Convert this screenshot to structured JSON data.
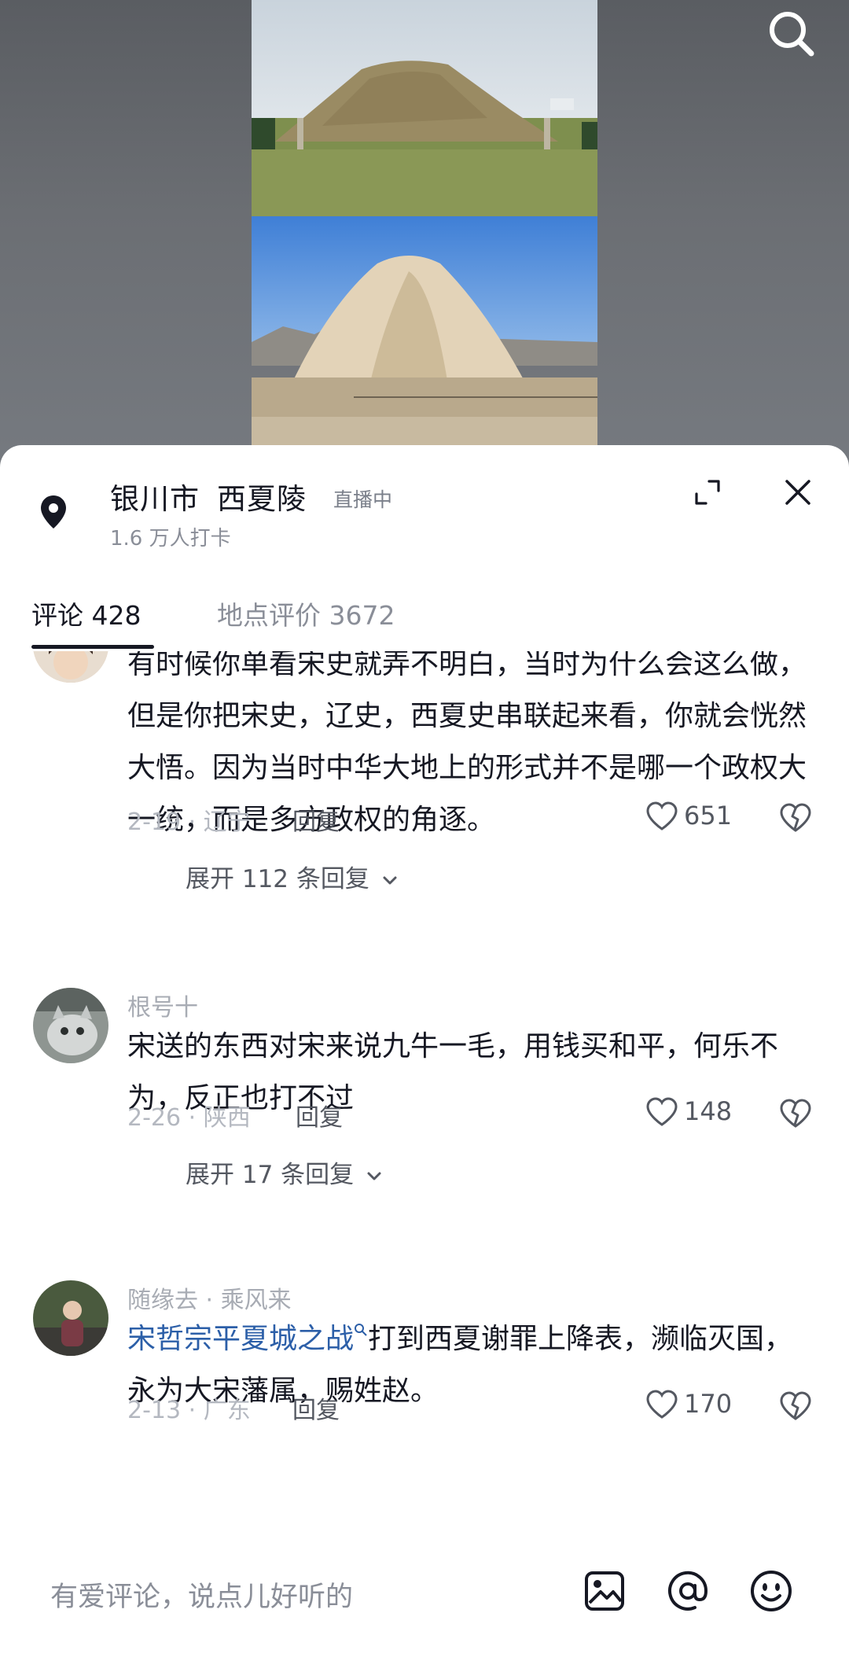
{
  "location": {
    "city": "银川市",
    "place": "西夏陵",
    "live_badge": "直播中",
    "checkins": "1.6 万人打卡"
  },
  "tabs": [
    {
      "label": "评论 428",
      "active": true
    },
    {
      "label": "地点评价 3672",
      "active": false
    }
  ],
  "comments": [
    {
      "text": "有时候你单看宋史就弄不明白，当时为什么会这么做，但是你把宋史，辽史，西夏史串联起来看，你就会恍然大悟。因为当时中华大地上的形式并不是哪一个政权大一统，而是多方政权的角逐。",
      "meta": "2-19 · 辽宁",
      "reply": "回复",
      "likes": "651",
      "expand": "展开 112 条回复"
    },
    {
      "username": "根号十",
      "text": "宋送的东西对宋来说九牛一毛，用钱买和平，何乐不为，反正也打不过",
      "meta": "2-26 · 陕西",
      "reply": "回复",
      "likes": "148",
      "expand": "展开 17 条回复"
    },
    {
      "username": "随缘去 · 乘风来",
      "tag": "宋哲宗平夏城之战",
      "text": "打到西夏谢罪上降表，濒临灭国，永为大宋藩属，赐姓赵。",
      "meta": "2-13 · 广东",
      "reply": "回复",
      "likes": "170"
    }
  ],
  "input": {
    "placeholder": "有爱评论，说点儿好听的"
  },
  "icons": {
    "search": "search-icon",
    "pin": "location-pin-icon",
    "expand": "expand-icon",
    "close": "close-icon",
    "like": "heart-icon",
    "dislike": "broken-heart-icon",
    "image": "image-icon",
    "mention": "at-icon",
    "emoji": "emoji-icon"
  }
}
